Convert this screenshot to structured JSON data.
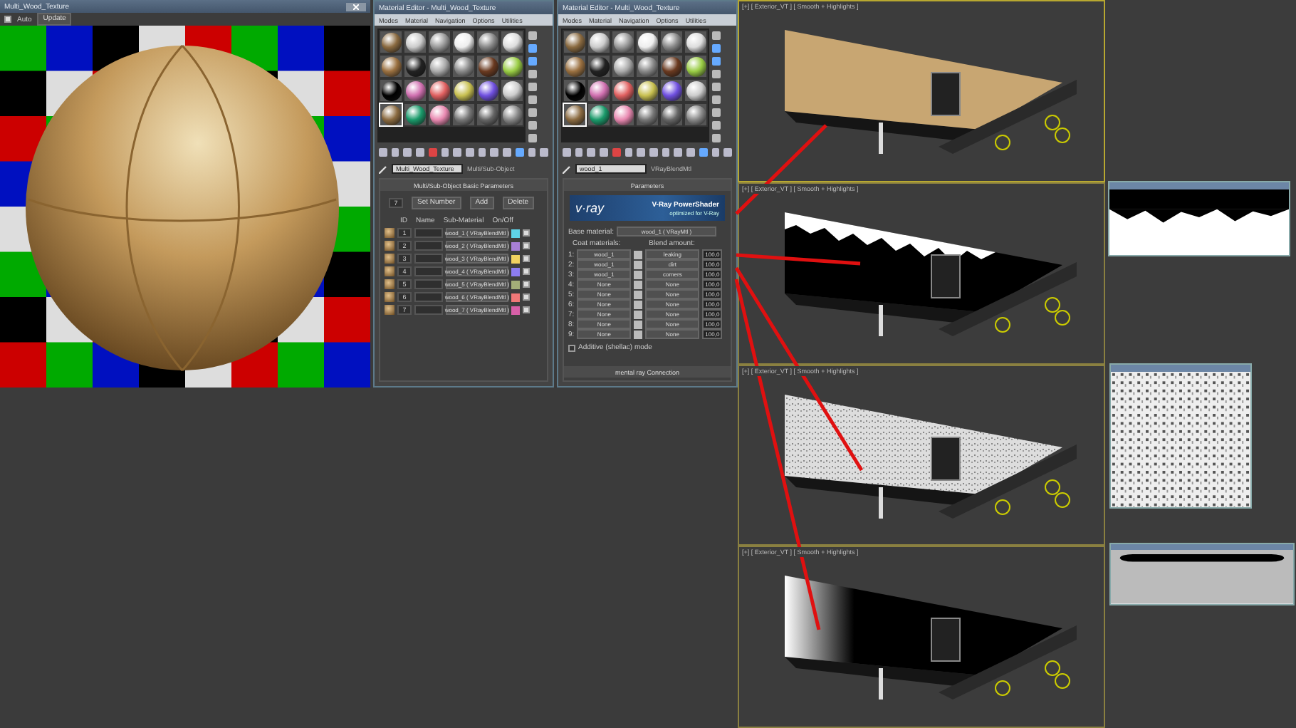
{
  "preview_window": {
    "title": "Multi_Wood_Texture",
    "auto": {
      "label": "Auto",
      "checked": true
    },
    "update_button": "Update"
  },
  "editors": [
    {
      "title": "Material Editor - Multi_Wood_Texture",
      "menu": [
        "Modes",
        "Material",
        "Navigation",
        "Options",
        "Utilities"
      ],
      "name": "Multi_Wood_Texture",
      "type": "Multi/Sub-Object",
      "kind": "multi",
      "rollout": {
        "title": "Multi/Sub-Object Basic Parameters",
        "count": "7",
        "buttons": [
          "Set Number",
          "Add",
          "Delete"
        ],
        "columns": [
          "ID",
          "Name",
          "Sub-Material",
          "On/Off"
        ],
        "rows": [
          {
            "id": "1",
            "sub_material": "wood_1 ( VRayBlendMtl )",
            "color": "#5fd3e8",
            "on": true
          },
          {
            "id": "2",
            "sub_material": "wood_2 ( VRayBlendMtl )",
            "color": "#a77fd6",
            "on": true
          },
          {
            "id": "3",
            "sub_material": "wood_3 ( VRayBlendMtl )",
            "color": "#f0d060",
            "on": true
          },
          {
            "id": "4",
            "sub_material": "wood_4 ( VRayBlendMtl )",
            "color": "#8c7cf0",
            "on": true
          },
          {
            "id": "5",
            "sub_material": "wood_5 ( VRayBlendMtl )",
            "color": "#a3ad78",
            "on": true
          },
          {
            "id": "6",
            "sub_material": "wood_6 ( VRayBlendMtl )",
            "color": "#f07878",
            "on": true
          },
          {
            "id": "7",
            "sub_material": "wood_7 ( VRayBlendMtl )",
            "color": "#d860a8",
            "on": true
          }
        ]
      }
    },
    {
      "title": "Material Editor - Multi_Wood_Texture",
      "menu": [
        "Modes",
        "Material",
        "Navigation",
        "Options",
        "Utilities"
      ],
      "name": "wood_1",
      "type": "VRayBlendMtl",
      "kind": "blend",
      "rollout": {
        "title": "Parameters",
        "banner": {
          "logo": "v·ray",
          "title": "V-Ray PowerShader",
          "subtitle": "optimized for V-Ray"
        },
        "base_label": "Base material:",
        "base_material": "wood_1 ( VRayMtl )",
        "coat_header": "Coat materials:",
        "blend_header": "Blend amount:",
        "rows": [
          {
            "index": "1:",
            "coat": "wood_1",
            "blend": "leaking",
            "amount": "100,0"
          },
          {
            "index": "2:",
            "coat": "wood_1",
            "blend": "dirt",
            "amount": "100,0"
          },
          {
            "index": "3:",
            "coat": "wood_1",
            "blend": "corners",
            "amount": "100,0"
          },
          {
            "index": "4:",
            "coat": "None",
            "blend": "None",
            "amount": "100,0"
          },
          {
            "index": "5:",
            "coat": "None",
            "blend": "None",
            "amount": "100,0"
          },
          {
            "index": "6:",
            "coat": "None",
            "blend": "None",
            "amount": "100,0"
          },
          {
            "index": "7:",
            "coat": "None",
            "blend": "None",
            "amount": "100,0"
          },
          {
            "index": "8:",
            "coat": "None",
            "blend": "None",
            "amount": "100,0"
          },
          {
            "index": "9:",
            "coat": "None",
            "blend": "None",
            "amount": "100,0"
          }
        ],
        "additive": {
          "label": "Additive (shellac) mode",
          "checked": false
        },
        "next_rollout": "mental ray Connection"
      }
    }
  ],
  "viewports": [
    {
      "label": "[+] [ Exterior_VT ] [ Smooth + Highlights ]",
      "kind": "wood",
      "selected": true
    },
    {
      "label": "[+] [ Exterior_VT ] [ Smooth + Highlights ]",
      "kind": "leaking",
      "selected": false
    },
    {
      "label": "[+] [ Exterior_VT ] [ Smooth + Highlights ]",
      "kind": "dirt",
      "selected": false
    },
    {
      "label": "[+] [ Exterior_VT ] [ Smooth + Highlights ]",
      "kind": "corners",
      "selected": false
    }
  ],
  "texture_windows": [
    {
      "kind": "leaking"
    },
    {
      "kind": "dirt"
    },
    {
      "kind": "corners"
    }
  ]
}
